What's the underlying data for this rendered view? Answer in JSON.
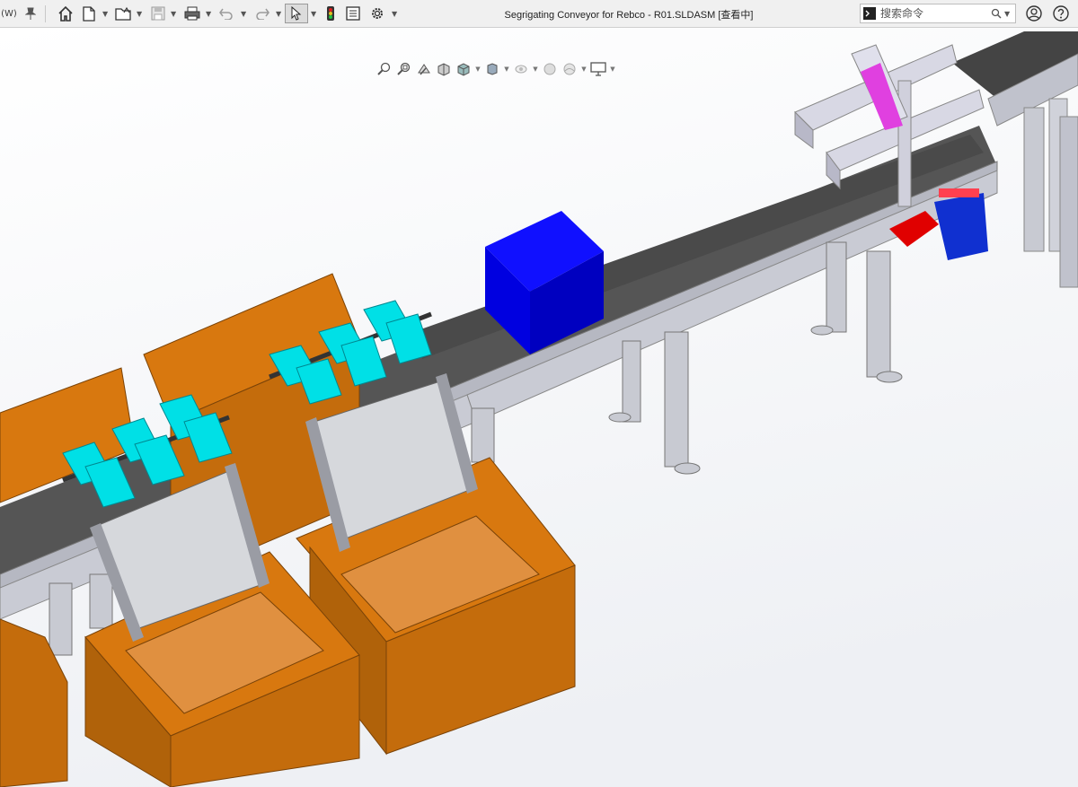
{
  "window": {
    "title": "Segrigating Conveyor for Rebco - R01.SLDASM [查看中]",
    "left_fragment": "(W)"
  },
  "search": {
    "placeholder": "搜索命令"
  },
  "toolbar_icons": [
    "pin-icon",
    "home-icon",
    "new-document-icon",
    "open-folder-icon",
    "save-icon",
    "print-icon",
    "undo-icon",
    "redo-icon",
    "select-arrow-icon",
    "traffic-light-icon",
    "file-properties-icon",
    "gear-icon"
  ],
  "view_icons": [
    "zoom-to-fit-icon",
    "zoom-to-area-icon",
    "previous-view-icon",
    "section-view-icon",
    "view-orientation-icon",
    "display-style-icon",
    "hide-show-icon",
    "appearance-icon",
    "scene-icon",
    "display-monitor-icon"
  ],
  "colors": {
    "toolbar_bg": "#f0f0f0",
    "crate": "#d8780f",
    "flap": "#00e0e6",
    "box": "#0000e0",
    "sensor_red": "#e00000",
    "sensor_blue": "#1030d0",
    "guide_magenta": "#e040e0",
    "belt": "#555555",
    "frame": "#c8c8d0"
  }
}
